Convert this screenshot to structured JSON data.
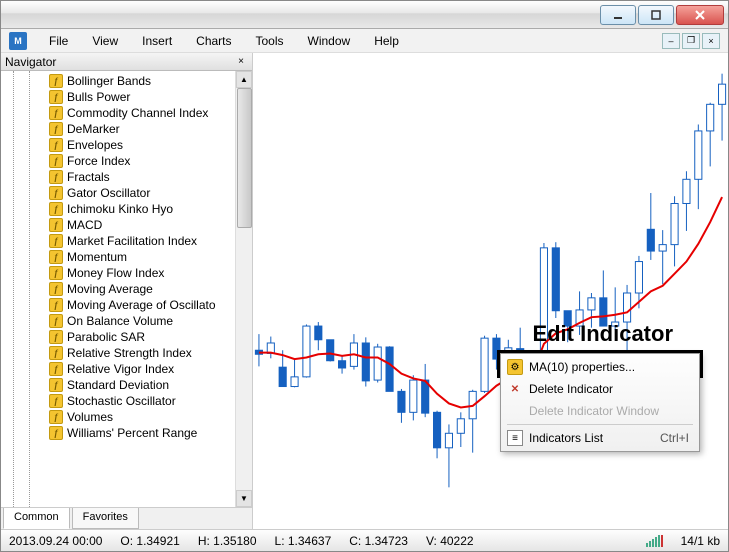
{
  "app_icon_text": "M",
  "menu": [
    "File",
    "View",
    "Insert",
    "Charts",
    "Tools",
    "Window",
    "Help"
  ],
  "navigator": {
    "title": "Navigator",
    "items": [
      "Bollinger Bands",
      "Bulls Power",
      "Commodity Channel Index",
      "DeMarker",
      "Envelopes",
      "Force Index",
      "Fractals",
      "Gator Oscillator",
      "Ichimoku Kinko Hyo",
      "MACD",
      "Market Facilitation Index",
      "Momentum",
      "Money Flow Index",
      "Moving Average",
      "Moving Average of Oscillato",
      "On Balance Volume",
      "Parabolic SAR",
      "Relative Strength Index",
      "Relative Vigor Index",
      "Standard Deviation",
      "Stochastic Oscillator",
      "Volumes",
      "Williams' Percent Range"
    ],
    "tabs": [
      "Common",
      "Favorites"
    ]
  },
  "context_menu": {
    "properties": "MA(10) properties...",
    "delete": "Delete Indicator",
    "delete_window": "Delete Indicator Window",
    "list": "Indicators List",
    "shortcut": "Ctrl+I"
  },
  "annotation": "Edit Indicator",
  "status": {
    "date": "2013.09.24 00:00",
    "open": "O: 1.34921",
    "high": "H: 1.35180",
    "low": "L: 1.34637",
    "close": "C: 1.34723",
    "vol": "V: 40222",
    "kb": "14/1 kb"
  },
  "chart_data": {
    "type": "candlestick-with-line",
    "notes": "values estimated from pixels; no axis shown in screenshot",
    "candles": [
      {
        "o": 1.349,
        "h": 1.351,
        "l": 1.347,
        "c": 1.3485
      },
      {
        "o": 1.3486,
        "h": 1.3507,
        "l": 1.348,
        "c": 1.3499
      },
      {
        "o": 1.3469,
        "h": 1.349,
        "l": 1.3445,
        "c": 1.3445
      },
      {
        "o": 1.3445,
        "h": 1.348,
        "l": 1.3444,
        "c": 1.3457
      },
      {
        "o": 1.3457,
        "h": 1.3522,
        "l": 1.3456,
        "c": 1.352
      },
      {
        "o": 1.352,
        "h": 1.3525,
        "l": 1.349,
        "c": 1.3503
      },
      {
        "o": 1.3503,
        "h": 1.3503,
        "l": 1.3476,
        "c": 1.3477
      },
      {
        "o": 1.3477,
        "h": 1.3484,
        "l": 1.3461,
        "c": 1.3468
      },
      {
        "o": 1.347,
        "h": 1.351,
        "l": 1.3466,
        "c": 1.3499
      },
      {
        "o": 1.3499,
        "h": 1.3506,
        "l": 1.3445,
        "c": 1.3452
      },
      {
        "o": 1.3453,
        "h": 1.3498,
        "l": 1.345,
        "c": 1.3494
      },
      {
        "o": 1.3494,
        "h": 1.3495,
        "l": 1.3439,
        "c": 1.3439
      },
      {
        "o": 1.3439,
        "h": 1.3442,
        "l": 1.34,
        "c": 1.3413
      },
      {
        "o": 1.3413,
        "h": 1.3459,
        "l": 1.3403,
        "c": 1.3453
      },
      {
        "o": 1.3453,
        "h": 1.3473,
        "l": 1.3407,
        "c": 1.3412
      },
      {
        "o": 1.3413,
        "h": 1.3415,
        "l": 1.3356,
        "c": 1.3369
      },
      {
        "o": 1.3369,
        "h": 1.3398,
        "l": 1.332,
        "c": 1.3387
      },
      {
        "o": 1.3387,
        "h": 1.3413,
        "l": 1.337,
        "c": 1.3405
      },
      {
        "o": 1.3405,
        "h": 1.3441,
        "l": 1.3363,
        "c": 1.3439
      },
      {
        "o": 1.3439,
        "h": 1.3508,
        "l": 1.3437,
        "c": 1.3505
      },
      {
        "o": 1.3505,
        "h": 1.351,
        "l": 1.3466,
        "c": 1.3479
      },
      {
        "o": 1.3479,
        "h": 1.3503,
        "l": 1.3462,
        "c": 1.3493
      },
      {
        "o": 1.3492,
        "h": 1.3518,
        "l": 1.3464,
        "c": 1.3472
      },
      {
        "o": 1.3472,
        "h": 1.349,
        "l": 1.345,
        "c": 1.3482
      },
      {
        "o": 1.3482,
        "h": 1.3623,
        "l": 1.348,
        "c": 1.3617
      },
      {
        "o": 1.3617,
        "h": 1.3624,
        "l": 1.353,
        "c": 1.3539
      },
      {
        "o": 1.3539,
        "h": 1.3539,
        "l": 1.35,
        "c": 1.352
      },
      {
        "o": 1.352,
        "h": 1.3563,
        "l": 1.3509,
        "c": 1.354
      },
      {
        "o": 1.354,
        "h": 1.3561,
        "l": 1.3518,
        "c": 1.3555
      },
      {
        "o": 1.3555,
        "h": 1.3589,
        "l": 1.352,
        "c": 1.352
      },
      {
        "o": 1.352,
        "h": 1.3568,
        "l": 1.3515,
        "c": 1.3525
      },
      {
        "o": 1.3525,
        "h": 1.3571,
        "l": 1.3471,
        "c": 1.3561
      },
      {
        "o": 1.3561,
        "h": 1.3607,
        "l": 1.3542,
        "c": 1.36
      },
      {
        "o": 1.364,
        "h": 1.3685,
        "l": 1.3602,
        "c": 1.3613
      },
      {
        "o": 1.3613,
        "h": 1.3639,
        "l": 1.3572,
        "c": 1.3621
      },
      {
        "o": 1.3621,
        "h": 1.3681,
        "l": 1.3594,
        "c": 1.3672
      },
      {
        "o": 1.3672,
        "h": 1.3712,
        "l": 1.3638,
        "c": 1.3702
      },
      {
        "o": 1.3702,
        "h": 1.377,
        "l": 1.3665,
        "c": 1.3762
      },
      {
        "o": 1.3762,
        "h": 1.3797,
        "l": 1.3718,
        "c": 1.3795
      },
      {
        "o": 1.3795,
        "h": 1.3833,
        "l": 1.375,
        "c": 1.382
      }
    ],
    "ma_line": [
      1.3487,
      1.3487,
      1.3484,
      1.3479,
      1.3481,
      1.3485,
      1.3486,
      1.3483,
      1.3485,
      1.3481,
      1.3481,
      1.3473,
      1.3461,
      1.3455,
      1.3452,
      1.3436,
      1.3424,
      1.3419,
      1.3421,
      1.3433,
      1.3446,
      1.3455,
      1.3459,
      1.346,
      1.3498,
      1.3511,
      1.3516,
      1.3524,
      1.3531,
      1.3532,
      1.3534,
      1.3537,
      1.355,
      1.3563,
      1.357,
      1.3585,
      1.36,
      1.3622,
      1.3649,
      1.368
    ]
  }
}
